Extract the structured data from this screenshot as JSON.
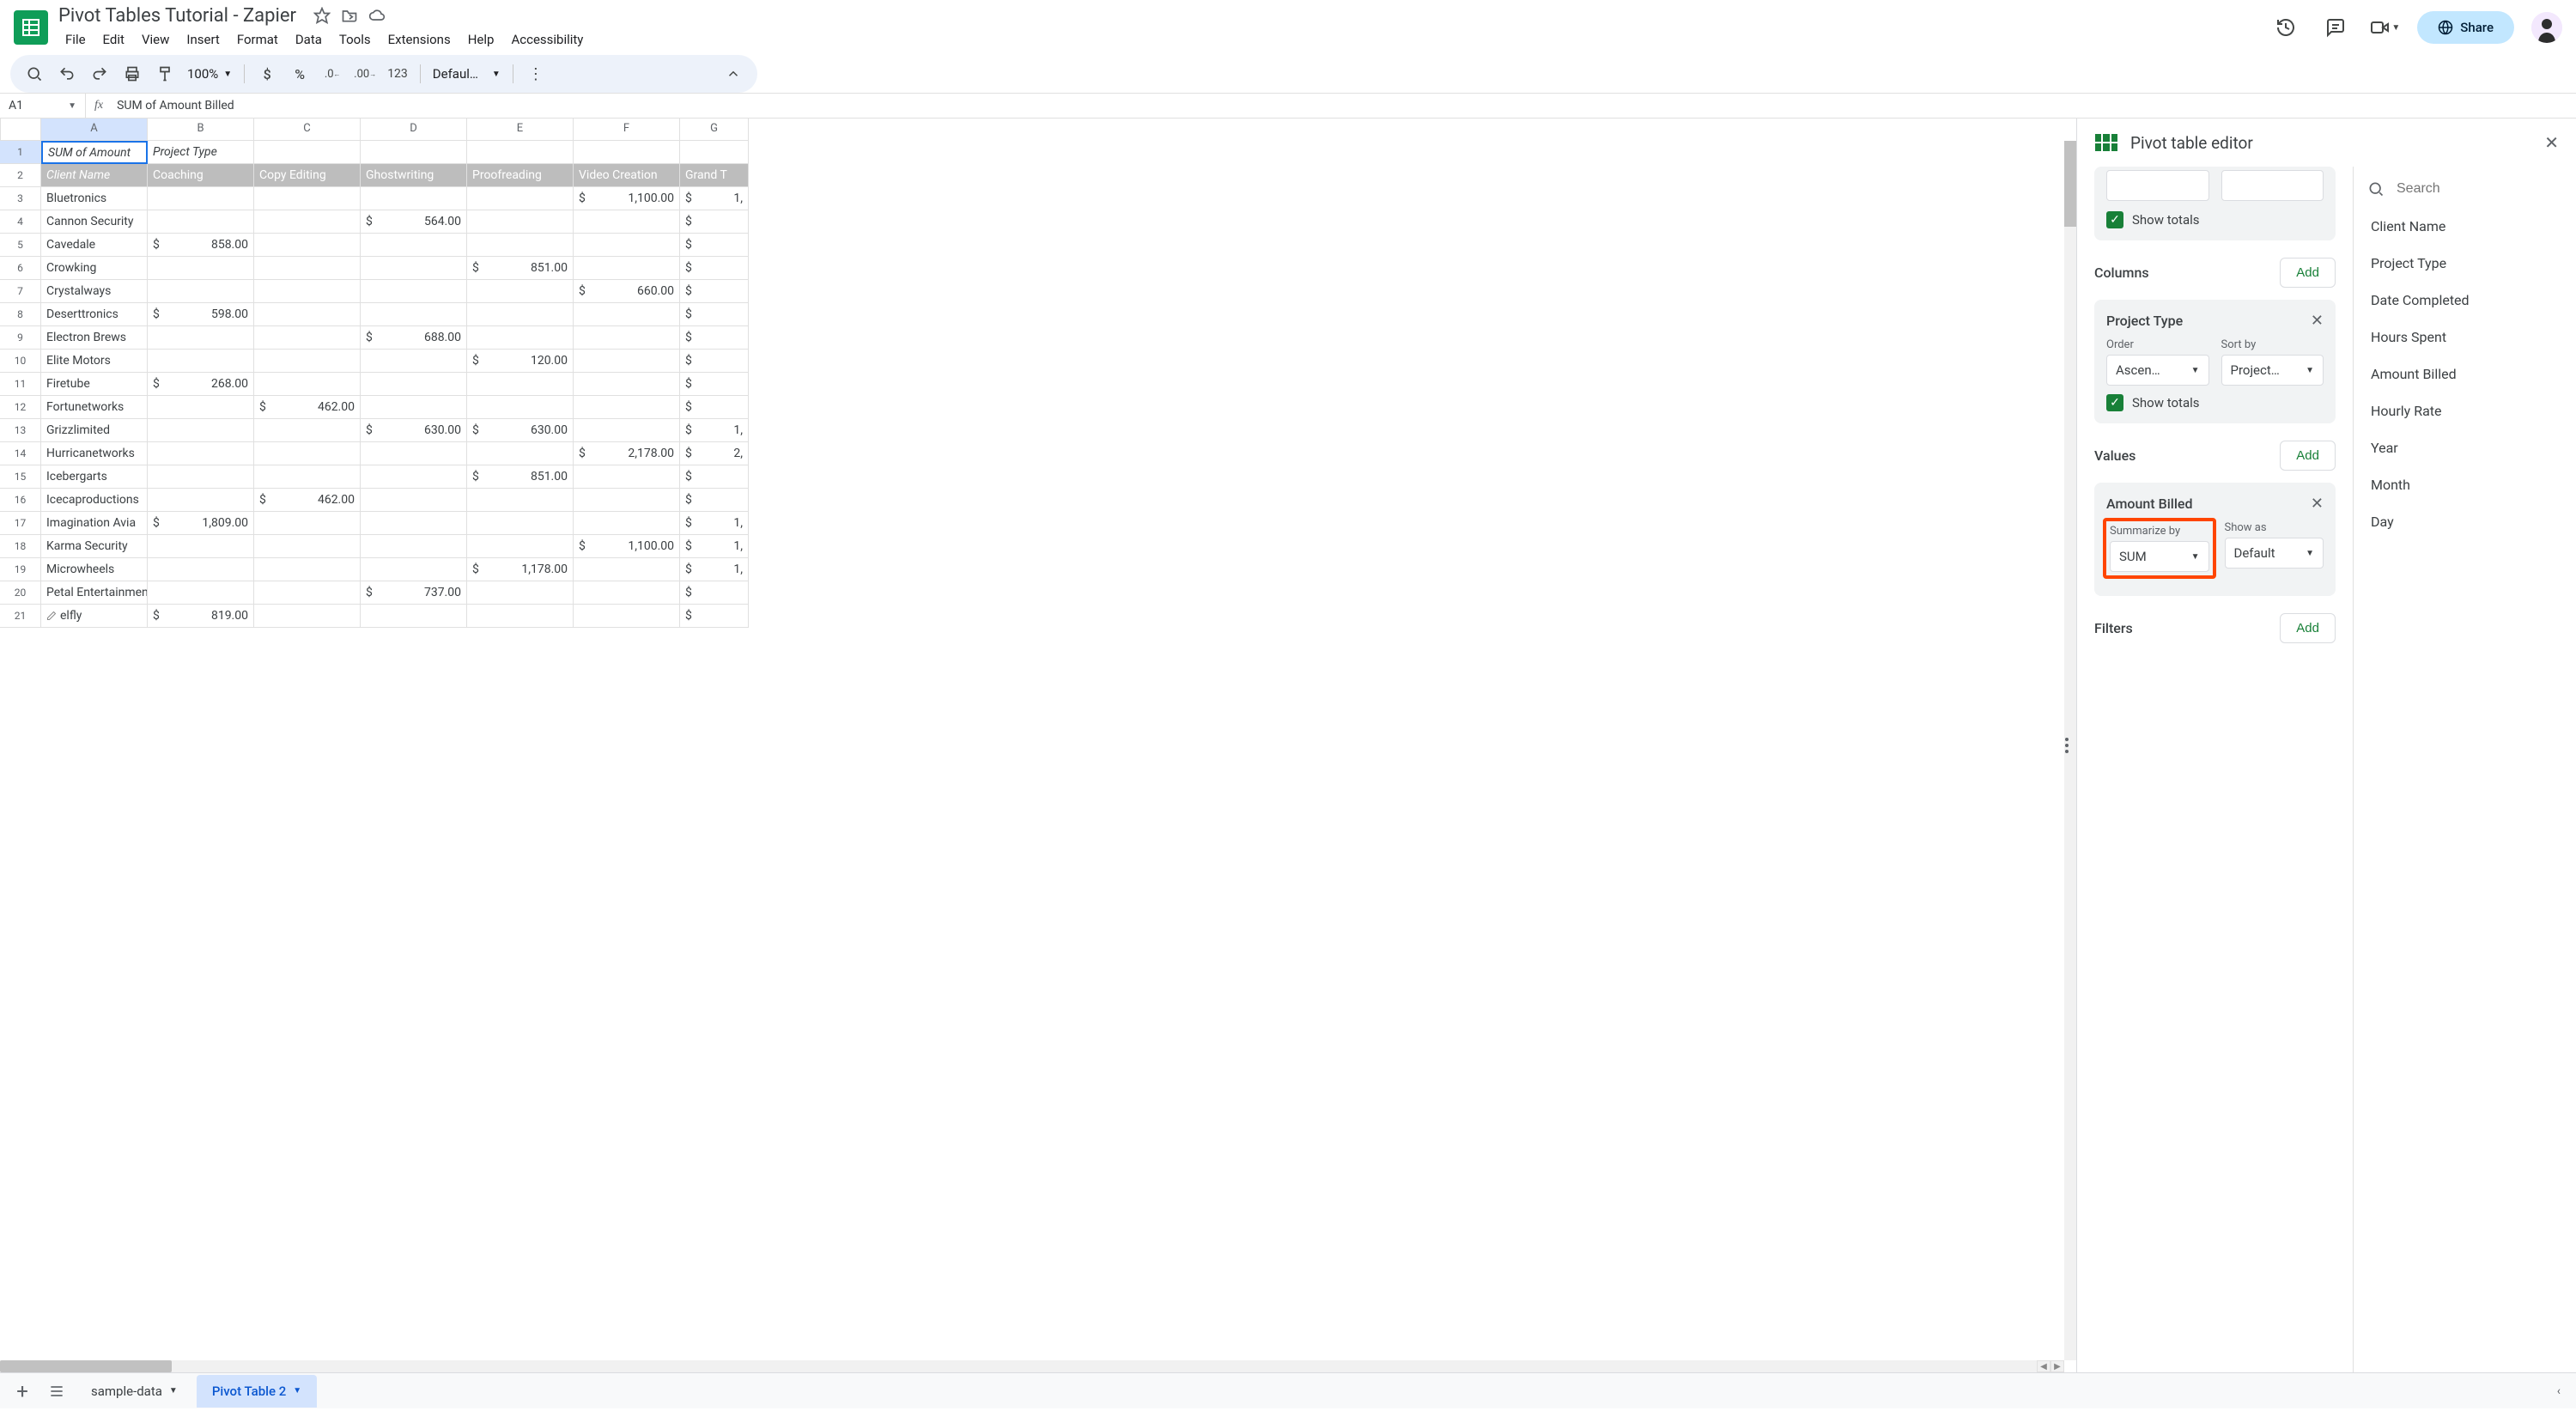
{
  "doc": {
    "title": "Pivot Tables Tutorial - Zapier"
  },
  "menu": [
    "File",
    "Edit",
    "View",
    "Insert",
    "Format",
    "Data",
    "Tools",
    "Extensions",
    "Help",
    "Accessibility"
  ],
  "share_label": "Share",
  "toolbar": {
    "zoom": "100%",
    "font": "Defaul…",
    "num_format": "123"
  },
  "name_box": "A1",
  "formula": "SUM of  Amount Billed",
  "columns": [
    "A",
    "B",
    "C",
    "D",
    "E",
    "F",
    "G"
  ],
  "grid": {
    "r1": {
      "a": "SUM of  Amount",
      "b": "Project Type"
    },
    "r2": {
      "a": "Client Name",
      "b": "Coaching",
      "c": "Copy Editing",
      "d": "Ghostwriting",
      "e": "Proofreading",
      "f": "Video Creation",
      "g": "Grand T"
    },
    "rows": [
      {
        "a": "Bluetronics",
        "b": "",
        "c": "",
        "d": "",
        "e": "",
        "f": "1,100.00",
        "fcur": "$",
        "g": "1,",
        "gcur": "$"
      },
      {
        "a": "Cannon Security",
        "b": "",
        "c": "",
        "d": "564.00",
        "dcur": "$",
        "e": "",
        "f": "",
        "g": "",
        "gcur": "$"
      },
      {
        "a": "Cavedale",
        "b": "858.00",
        "bcur": "$",
        "c": "",
        "d": "",
        "e": "",
        "f": "",
        "g": "",
        "gcur": "$"
      },
      {
        "a": "Crowking",
        "b": "",
        "c": "",
        "d": "",
        "e": "851.00",
        "ecur": "$",
        "f": "",
        "g": "",
        "gcur": "$"
      },
      {
        "a": "Crystalways",
        "b": "",
        "c": "",
        "d": "",
        "e": "",
        "f": "660.00",
        "fcur": "$",
        "g": "",
        "gcur": "$"
      },
      {
        "a": "Deserttronics",
        "b": "598.00",
        "bcur": "$",
        "c": "",
        "d": "",
        "e": "",
        "f": "",
        "g": "",
        "gcur": "$"
      },
      {
        "a": "Electron Brews",
        "b": "",
        "c": "",
        "d": "688.00",
        "dcur": "$",
        "e": "",
        "f": "",
        "g": "",
        "gcur": "$"
      },
      {
        "a": "Elite Motors",
        "b": "",
        "c": "",
        "d": "",
        "e": "120.00",
        "ecur": "$",
        "f": "",
        "g": "",
        "gcur": "$"
      },
      {
        "a": "Firetube",
        "b": "268.00",
        "bcur": "$",
        "c": "",
        "d": "",
        "e": "",
        "f": "",
        "g": "",
        "gcur": "$"
      },
      {
        "a": "Fortunetworks",
        "b": "",
        "c": "462.00",
        "ccur": "$",
        "d": "",
        "e": "",
        "f": "",
        "g": "",
        "gcur": "$"
      },
      {
        "a": "Grizzlimited",
        "b": "",
        "c": "",
        "d": "630.00",
        "dcur": "$",
        "e": "630.00",
        "ecur": "$",
        "f": "",
        "g": "1,",
        "gcur": "$"
      },
      {
        "a": "Hurricanetworks",
        "b": "",
        "c": "",
        "d": "",
        "e": "",
        "f": "2,178.00",
        "fcur": "$",
        "g": "2,",
        "gcur": "$"
      },
      {
        "a": "Icebergarts",
        "b": "",
        "c": "",
        "d": "",
        "e": "851.00",
        "ecur": "$",
        "f": "",
        "g": "",
        "gcur": "$"
      },
      {
        "a": "Icecaproductions",
        "b": "",
        "c": "462.00",
        "ccur": "$",
        "d": "",
        "e": "",
        "f": "",
        "g": "",
        "gcur": "$"
      },
      {
        "a": "Imagination Avia",
        "b": "1,809.00",
        "bcur": "$",
        "c": "",
        "d": "",
        "e": "",
        "f": "",
        "g": "1,",
        "gcur": "$"
      },
      {
        "a": "Karma Security",
        "b": "",
        "c": "",
        "d": "",
        "e": "",
        "f": "1,100.00",
        "fcur": "$",
        "g": "1,",
        "gcur": "$"
      },
      {
        "a": "Microwheels",
        "b": "",
        "c": "",
        "d": "",
        "e": "1,178.00",
        "ecur": "$",
        "f": "",
        "g": "1,",
        "gcur": "$"
      },
      {
        "a": "Petal Entertainment",
        "b": "",
        "c": "",
        "d": "737.00",
        "dcur": "$",
        "e": "",
        "f": "",
        "g": "",
        "gcur": "$"
      },
      {
        "a": "elfly",
        "b": "819.00",
        "bcur": "$",
        "c": "",
        "d": "",
        "e": "",
        "f": "",
        "g": "",
        "gcur": "$"
      }
    ]
  },
  "panel": {
    "title": "Pivot table editor",
    "search_placeholder": "Search",
    "fields": [
      "Client Name",
      "Project Type",
      "Date Completed",
      "Hours Spent",
      "Amount Billed",
      "Hourly Rate",
      "Year",
      "Month",
      "Day"
    ],
    "show_totals": "Show totals",
    "columns_label": "Columns",
    "values_label": "Values",
    "filters_label": "Filters",
    "add_label": "Add",
    "chip_columns": {
      "title": "Project Type",
      "order_label": "Order",
      "order_value": "Ascen…",
      "sort_label": "Sort by",
      "sort_value": "Project …"
    },
    "chip_values": {
      "title": "Amount Billed",
      "summarize_label": "Summarize by",
      "summarize_value": "SUM",
      "showas_label": "Show as",
      "showas_value": "Default"
    }
  },
  "tabs": {
    "add": "+",
    "sheet1": "sample-data",
    "sheet2": "Pivot Table 2"
  }
}
